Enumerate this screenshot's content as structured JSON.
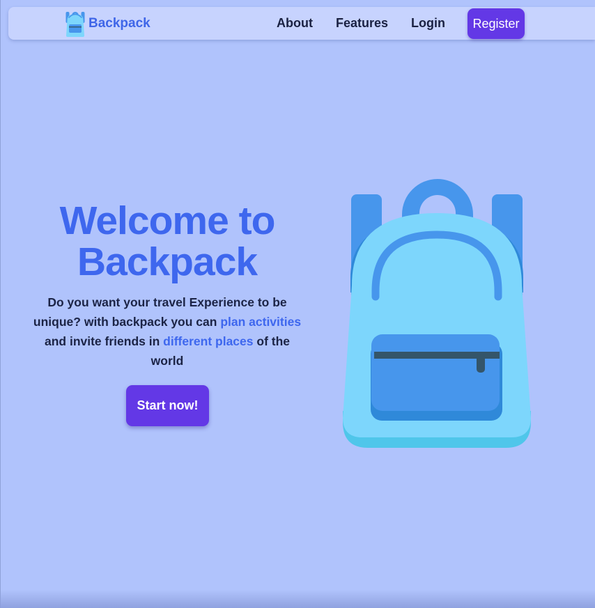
{
  "navbar": {
    "brand_name": "Backpack",
    "links": [
      "About",
      "Features",
      "Login"
    ],
    "register_label": "Register"
  },
  "hero": {
    "title_line1": "Welcome to",
    "title_line2": "Backpack",
    "desc_part1": "Do you want your travel Experience to be unique? with backpack you can ",
    "desc_highlight1": "plan activities",
    "desc_part2": " and invite friends in ",
    "desc_highlight2": "different places",
    "desc_part3": " of the world",
    "cta_label": "Start now!"
  },
  "colors": {
    "page_background": "#b0c3fc",
    "navbar_background": "#c7d3fe",
    "accent": "#3e67ee",
    "button": "#6338e6",
    "text": "#1c2446"
  },
  "icons": {
    "logo": "backpack-logo-icon",
    "illustration": "backpack-illustration"
  }
}
